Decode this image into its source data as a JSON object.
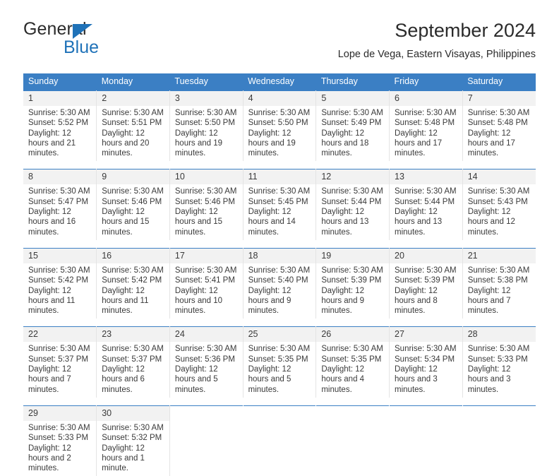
{
  "brand": {
    "name_top": "General",
    "name_bottom": "Blue",
    "triangle_color": "#1f72b8",
    "text_color": "#2b2b2b"
  },
  "header": {
    "title": "September 2024",
    "subtitle": "Lope de Vega, Eastern Visayas, Philippines"
  },
  "theme": {
    "header_bg": "#3b7fc4",
    "header_text": "#ffffff",
    "daynum_bg": "#f2f2f2",
    "cell_bg": "#ffffff",
    "body_text": "#3a3a3a",
    "divider": "#e4e4e4"
  },
  "calendar": {
    "weekday_headers": [
      "Sunday",
      "Monday",
      "Tuesday",
      "Wednesday",
      "Thursday",
      "Friday",
      "Saturday"
    ],
    "weeks": [
      [
        {
          "day": "1",
          "sunrise": "Sunrise: 5:30 AM",
          "sunset": "Sunset: 5:52 PM",
          "daylight": "Daylight: 12 hours and 21 minutes."
        },
        {
          "day": "2",
          "sunrise": "Sunrise: 5:30 AM",
          "sunset": "Sunset: 5:51 PM",
          "daylight": "Daylight: 12 hours and 20 minutes."
        },
        {
          "day": "3",
          "sunrise": "Sunrise: 5:30 AM",
          "sunset": "Sunset: 5:50 PM",
          "daylight": "Daylight: 12 hours and 19 minutes."
        },
        {
          "day": "4",
          "sunrise": "Sunrise: 5:30 AM",
          "sunset": "Sunset: 5:50 PM",
          "daylight": "Daylight: 12 hours and 19 minutes."
        },
        {
          "day": "5",
          "sunrise": "Sunrise: 5:30 AM",
          "sunset": "Sunset: 5:49 PM",
          "daylight": "Daylight: 12 hours and 18 minutes."
        },
        {
          "day": "6",
          "sunrise": "Sunrise: 5:30 AM",
          "sunset": "Sunset: 5:48 PM",
          "daylight": "Daylight: 12 hours and 17 minutes."
        },
        {
          "day": "7",
          "sunrise": "Sunrise: 5:30 AM",
          "sunset": "Sunset: 5:48 PM",
          "daylight": "Daylight: 12 hours and 17 minutes."
        }
      ],
      [
        {
          "day": "8",
          "sunrise": "Sunrise: 5:30 AM",
          "sunset": "Sunset: 5:47 PM",
          "daylight": "Daylight: 12 hours and 16 minutes."
        },
        {
          "day": "9",
          "sunrise": "Sunrise: 5:30 AM",
          "sunset": "Sunset: 5:46 PM",
          "daylight": "Daylight: 12 hours and 15 minutes."
        },
        {
          "day": "10",
          "sunrise": "Sunrise: 5:30 AM",
          "sunset": "Sunset: 5:46 PM",
          "daylight": "Daylight: 12 hours and 15 minutes."
        },
        {
          "day": "11",
          "sunrise": "Sunrise: 5:30 AM",
          "sunset": "Sunset: 5:45 PM",
          "daylight": "Daylight: 12 hours and 14 minutes."
        },
        {
          "day": "12",
          "sunrise": "Sunrise: 5:30 AM",
          "sunset": "Sunset: 5:44 PM",
          "daylight": "Daylight: 12 hours and 13 minutes."
        },
        {
          "day": "13",
          "sunrise": "Sunrise: 5:30 AM",
          "sunset": "Sunset: 5:44 PM",
          "daylight": "Daylight: 12 hours and 13 minutes."
        },
        {
          "day": "14",
          "sunrise": "Sunrise: 5:30 AM",
          "sunset": "Sunset: 5:43 PM",
          "daylight": "Daylight: 12 hours and 12 minutes."
        }
      ],
      [
        {
          "day": "15",
          "sunrise": "Sunrise: 5:30 AM",
          "sunset": "Sunset: 5:42 PM",
          "daylight": "Daylight: 12 hours and 11 minutes."
        },
        {
          "day": "16",
          "sunrise": "Sunrise: 5:30 AM",
          "sunset": "Sunset: 5:42 PM",
          "daylight": "Daylight: 12 hours and 11 minutes."
        },
        {
          "day": "17",
          "sunrise": "Sunrise: 5:30 AM",
          "sunset": "Sunset: 5:41 PM",
          "daylight": "Daylight: 12 hours and 10 minutes."
        },
        {
          "day": "18",
          "sunrise": "Sunrise: 5:30 AM",
          "sunset": "Sunset: 5:40 PM",
          "daylight": "Daylight: 12 hours and 9 minutes."
        },
        {
          "day": "19",
          "sunrise": "Sunrise: 5:30 AM",
          "sunset": "Sunset: 5:39 PM",
          "daylight": "Daylight: 12 hours and 9 minutes."
        },
        {
          "day": "20",
          "sunrise": "Sunrise: 5:30 AM",
          "sunset": "Sunset: 5:39 PM",
          "daylight": "Daylight: 12 hours and 8 minutes."
        },
        {
          "day": "21",
          "sunrise": "Sunrise: 5:30 AM",
          "sunset": "Sunset: 5:38 PM",
          "daylight": "Daylight: 12 hours and 7 minutes."
        }
      ],
      [
        {
          "day": "22",
          "sunrise": "Sunrise: 5:30 AM",
          "sunset": "Sunset: 5:37 PM",
          "daylight": "Daylight: 12 hours and 7 minutes."
        },
        {
          "day": "23",
          "sunrise": "Sunrise: 5:30 AM",
          "sunset": "Sunset: 5:37 PM",
          "daylight": "Daylight: 12 hours and 6 minutes."
        },
        {
          "day": "24",
          "sunrise": "Sunrise: 5:30 AM",
          "sunset": "Sunset: 5:36 PM",
          "daylight": "Daylight: 12 hours and 5 minutes."
        },
        {
          "day": "25",
          "sunrise": "Sunrise: 5:30 AM",
          "sunset": "Sunset: 5:35 PM",
          "daylight": "Daylight: 12 hours and 5 minutes."
        },
        {
          "day": "26",
          "sunrise": "Sunrise: 5:30 AM",
          "sunset": "Sunset: 5:35 PM",
          "daylight": "Daylight: 12 hours and 4 minutes."
        },
        {
          "day": "27",
          "sunrise": "Sunrise: 5:30 AM",
          "sunset": "Sunset: 5:34 PM",
          "daylight": "Daylight: 12 hours and 3 minutes."
        },
        {
          "day": "28",
          "sunrise": "Sunrise: 5:30 AM",
          "sunset": "Sunset: 5:33 PM",
          "daylight": "Daylight: 12 hours and 3 minutes."
        }
      ],
      [
        {
          "day": "29",
          "sunrise": "Sunrise: 5:30 AM",
          "sunset": "Sunset: 5:33 PM",
          "daylight": "Daylight: 12 hours and 2 minutes."
        },
        {
          "day": "30",
          "sunrise": "Sunrise: 5:30 AM",
          "sunset": "Sunset: 5:32 PM",
          "daylight": "Daylight: 12 hours and 1 minute."
        },
        {
          "day": "",
          "sunrise": "",
          "sunset": "",
          "daylight": ""
        },
        {
          "day": "",
          "sunrise": "",
          "sunset": "",
          "daylight": ""
        },
        {
          "day": "",
          "sunrise": "",
          "sunset": "",
          "daylight": ""
        },
        {
          "day": "",
          "sunrise": "",
          "sunset": "",
          "daylight": ""
        },
        {
          "day": "",
          "sunrise": "",
          "sunset": "",
          "daylight": ""
        }
      ]
    ]
  }
}
